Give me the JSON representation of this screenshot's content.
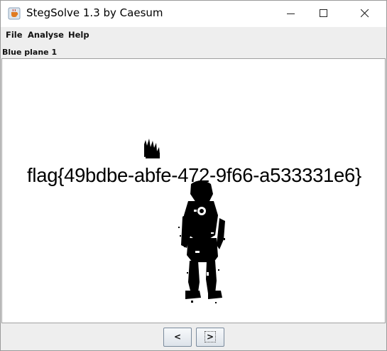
{
  "window": {
    "title": "StegSolve 1.3 by Caesum",
    "icon": "java-cup-icon",
    "controls": [
      "minimize-icon",
      "maximize-icon",
      "close-icon"
    ]
  },
  "menubar": {
    "items": [
      {
        "label": "File"
      },
      {
        "label": "Analyse"
      },
      {
        "label": "Help"
      }
    ]
  },
  "view": {
    "plane_label": "Blue plane 1",
    "flag_text": "flag{49bdbe-abfe-472-9f66-a533331e6}"
  },
  "navigation": {
    "prev_label": "<",
    "next_label": ">"
  }
}
